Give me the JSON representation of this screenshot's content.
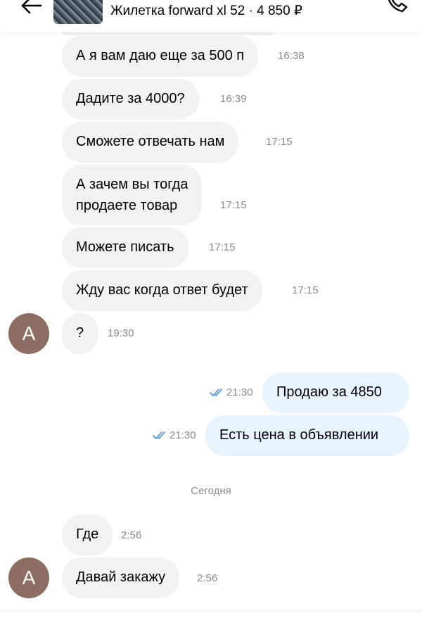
{
  "header": {
    "item_title": "Жилетка forward xl 52 · 4 850 ₽"
  },
  "avatar_letter": "А",
  "messages": [
    {
      "text": "А я вам даю еще за 500 п",
      "time": "16:38"
    },
    {
      "text": "Дадите за 4000?",
      "time": "16:39"
    },
    {
      "text": "Сможете отвечать нам",
      "time": "17:15"
    },
    {
      "text_line1": "А зачем вы тогда",
      "text_line2": "продаете товар",
      "time": "17:15"
    },
    {
      "text": "Можете писать",
      "time": "17:15"
    },
    {
      "text": "Жду вас когда ответ будет",
      "time": "17:15"
    },
    {
      "text": "?",
      "time": "19:30"
    },
    {
      "text": "Продаю за 4850",
      "time": "21:30"
    },
    {
      "text": "Есть цена в объявлении",
      "time": "21:30"
    },
    {
      "text": "Где",
      "time": "2:56"
    },
    {
      "text": "Давай закажу",
      "time": "2:56"
    }
  ],
  "date_separator": "Сегодня",
  "colors": {
    "incoming_bubble": "#f2f2f2",
    "outgoing_bubble": "#e8f4fd",
    "avatar": "#8e6e62",
    "read_ticks": "#3d8fe0"
  },
  "icons": [
    "back-arrow-icon",
    "phone-icon",
    "double-check-icon"
  ]
}
